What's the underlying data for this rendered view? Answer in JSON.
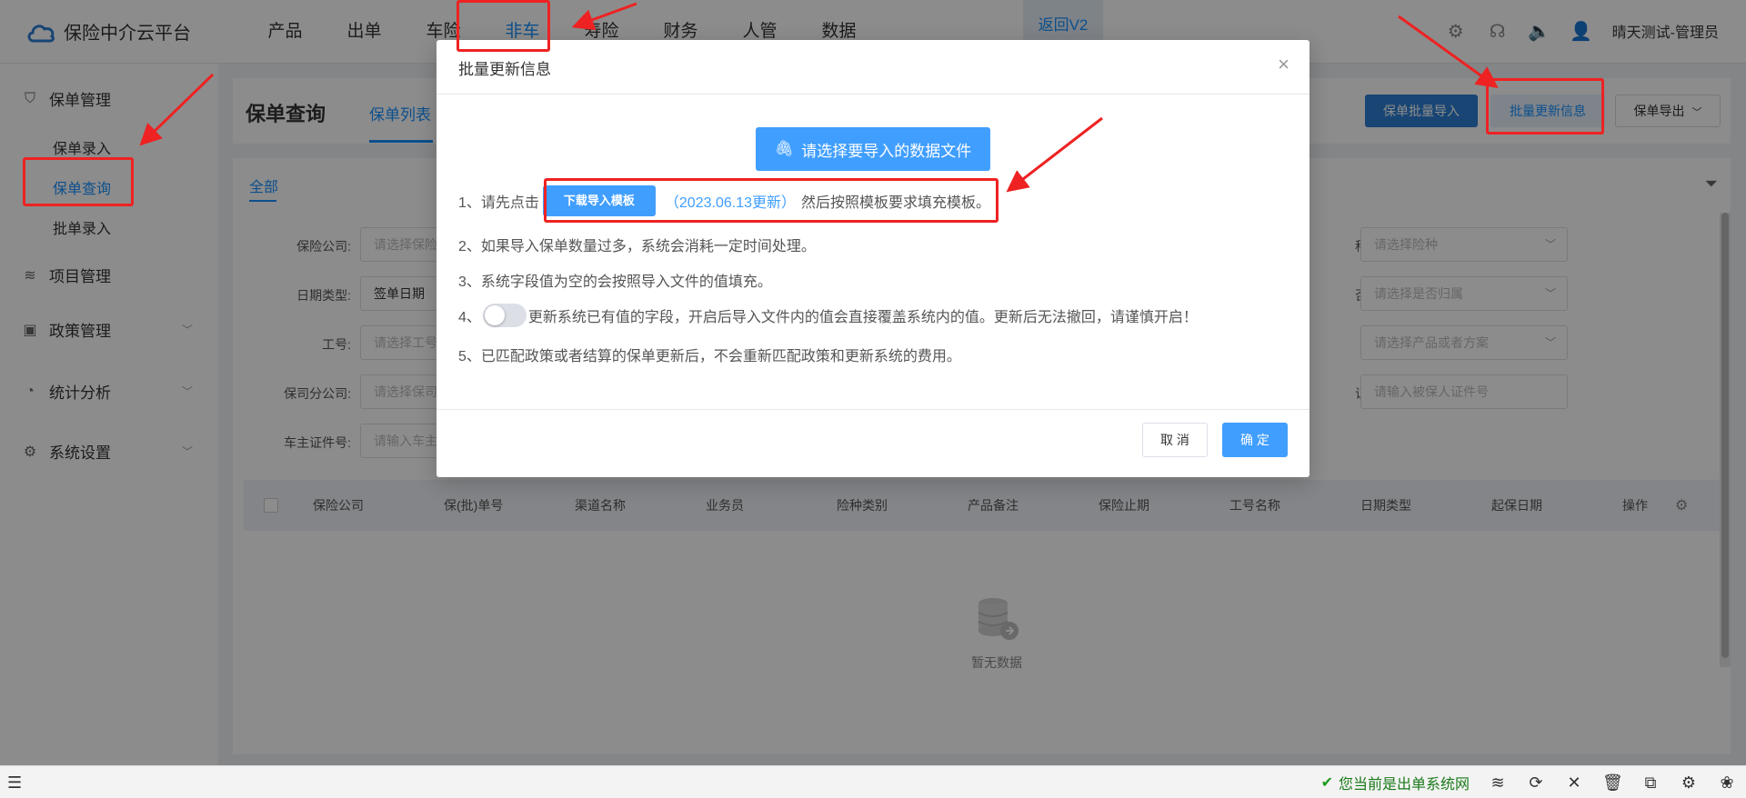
{
  "app": {
    "logo_text": "保险中介云平台",
    "nav": [
      "产品",
      "出单",
      "车险",
      "非车",
      "寿险",
      "财务",
      "人管",
      "数据"
    ],
    "nav_active_index": 3,
    "v2_label": "返回V2",
    "user_name": "晴天测试-管理员"
  },
  "sidebar": {
    "groups": [
      {
        "label": "保单管理",
        "icon": "shield-icon"
      },
      {
        "label": "项目管理",
        "icon": "layers-icon"
      },
      {
        "label": "政策管理",
        "icon": "wallet-icon"
      },
      {
        "label": "统计分析",
        "icon": "pie-chart-icon"
      },
      {
        "label": "系统设置",
        "icon": "gear-icon"
      }
    ],
    "subitems": [
      "保单录入",
      "保单查询",
      "批单录入"
    ],
    "active_sub_index": 1
  },
  "page": {
    "title": "保单查询",
    "tab": "保单列表",
    "buttons": {
      "batch_import": "保单批量导入",
      "batch_update": "批量更新信息",
      "export": "保单导出"
    },
    "filter_tab": "全部",
    "filters": {
      "insurer_label": "保险公司:",
      "insurer_placeholder": "请选择保险",
      "date_type_label": "日期类型:",
      "date_type_value": "签单日期",
      "job_no_label": "工号:",
      "job_no_placeholder": "请选择工号",
      "branch_label": "保司分公司:",
      "branch_placeholder": "请选择保司",
      "owner_id_label": "车主证件号:",
      "owner_id_placeholder": "请输入车主",
      "kind_label": "种类别:",
      "kind_placeholder": "请选择险种",
      "belong_label": "否归属:",
      "belong_placeholder": "请选择是否归属",
      "product_label": "产品:",
      "product_placeholder": "请选择产品或者方案",
      "cert_label": "证件号:",
      "cert_placeholder": "请输入被保人证件号"
    },
    "columns": [
      "保险公司",
      "保(批)单号",
      "渠道名称",
      "业务员",
      "险种类别",
      "产品备注",
      "保险止期",
      "工号名称",
      "日期类型",
      "起保日期"
    ],
    "ops_label": "操作",
    "empty_text": "暂无数据"
  },
  "modal": {
    "title": "批量更新信息",
    "upload_label": "请选择要导入的数据文件",
    "step1_prefix": "1、请先点击",
    "download_label": "下载导入模板",
    "template_date": "（2023.06.13更新）",
    "step1_suffix": "然后按照模板要求填充模板。",
    "step2": "2、如果导入保单数量过多，系统会消耗一定时间处理。",
    "step3": "3、系统字段值为空的会按照导入文件的值填充。",
    "step4_prefix": "4、",
    "step4_text": "更新系统已有值的字段，开启后导入文件内的值会直接覆盖系统内的值。更新后无法撤回，请谨慎开启！",
    "step5": "5、已匹配政策或者结算的保单更新后，不会重新匹配政策和更新系统的费用。",
    "cancel_label": "取 消",
    "ok_label": "确 定",
    "overwrite_toggle_on": false
  },
  "statusbar": {
    "status_text": "您当前是出单系统网"
  },
  "colors": {
    "primary": "#409eff",
    "annotation_red": "#ee2222"
  }
}
